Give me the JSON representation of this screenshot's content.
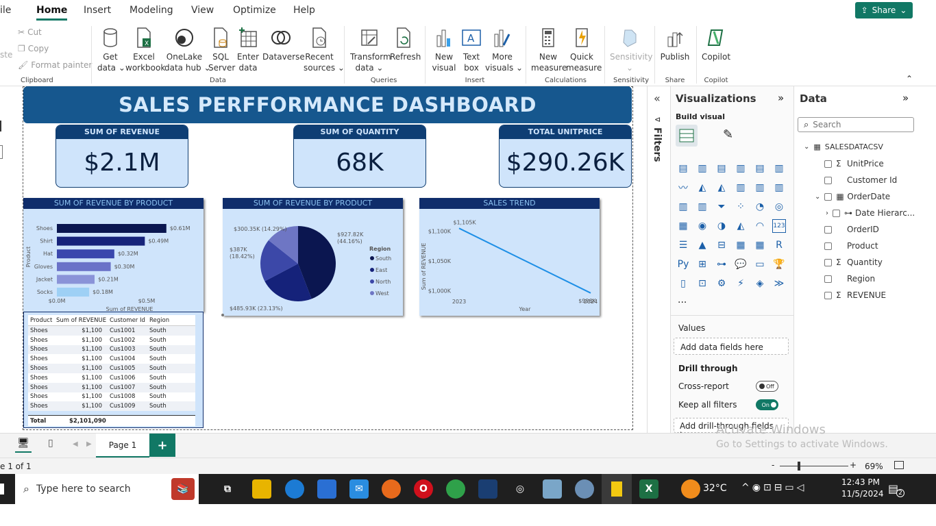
{
  "menu": {
    "file": "ile",
    "home": "Home",
    "insert": "Insert",
    "modeling": "Modeling",
    "view": "View",
    "optimize": "Optimize",
    "help": "Help",
    "share": "Share"
  },
  "ribbon": {
    "clipboard": {
      "paste": "ste",
      "cut": "Cut",
      "copy": "Copy",
      "format_painter": "Format painter",
      "group": "Clipboard"
    },
    "data": {
      "get_data": "Get\ndata ⌄",
      "excel": "Excel\nworkbook",
      "onelake": "OneLake\ndata hub ⌄",
      "sql": "SQL\nServer",
      "enter": "Enter\ndata",
      "dataverse": "Dataverse",
      "recent": "Recent\nsources ⌄",
      "group": "Data"
    },
    "queries": {
      "transform": "Transform\ndata ⌄",
      "refresh": "Refresh",
      "group": "Queries"
    },
    "insert": {
      "new_visual": "New\nvisual",
      "text_box": "Text\nbox",
      "more_visuals": "More\nvisuals ⌄",
      "group": "Insert"
    },
    "calculations": {
      "new_measure": "New\nmeasure",
      "quick_measure": "Quick\nmeasure",
      "group": "Calculations"
    },
    "sensitivity": {
      "label": "Sensitivity\n⌄",
      "group": "Sensitivity"
    },
    "share": {
      "publish": "Publish",
      "group": "Share"
    },
    "copilot": {
      "label": "Copilot",
      "group": "Copilot"
    }
  },
  "dashboard": {
    "title": "SALES PERFFORMANCE DASHBOARD",
    "kpis": [
      {
        "label": "SUM OF REVENUE",
        "value": "$2.1M"
      },
      {
        "label": "SUM OF QUANTITY",
        "value": "68K"
      },
      {
        "label": "TOTAL UNITPRICE",
        "value": "$290.26K"
      }
    ]
  },
  "chart_data": [
    {
      "type": "bar",
      "title": "SUM OF REVENUE BY PRODUCT",
      "orientation": "horizontal",
      "categories": [
        "Shoes",
        "Shirt",
        "Hat",
        "Gloves",
        "Jacket",
        "Socks"
      ],
      "values": [
        0.61,
        0.49,
        0.32,
        0.3,
        0.21,
        0.18
      ],
      "data_labels": [
        "$0.61M",
        "$0.49M",
        "$0.32M",
        "$0.30M",
        "$0.21M",
        "$0.18M"
      ],
      "xticks": [
        "$0.0M",
        "$0.5M"
      ],
      "xlabel": "Sum of REVENUE",
      "ylabel": "Product",
      "xlim": [
        0,
        0.75
      ],
      "colors": [
        "#0a1650",
        "#16237a",
        "#3a47ad",
        "#6a72c8",
        "#8a93d8",
        "#9ed0f5"
      ]
    },
    {
      "type": "pie",
      "title": "SUM OF REVENUE BY PRODUCT",
      "legend_title": "Region",
      "legend_position": "right",
      "slices": [
        {
          "name": "South",
          "value": 927.82,
          "label": "$927.82K\n(44.16%)",
          "color": "#0b1650"
        },
        {
          "name": "East",
          "value": 485.93,
          "label": "$485.93K (23.13%)",
          "color": "#15227a"
        },
        {
          "name": "North",
          "value": 387,
          "label": "$387K\n(18.42%)",
          "color": "#3c48a8"
        },
        {
          "name": "West",
          "value": 300.35,
          "label": "$300.35K (14.29%)",
          "color": "#6e76c4"
        }
      ]
    },
    {
      "type": "line",
      "title": "SALES TREND",
      "x": [
        "2023",
        "2024"
      ],
      "y": [
        1105,
        996
      ],
      "point_labels": [
        "$1,105K",
        "$996K"
      ],
      "yticks": [
        "$1,100K",
        "$1,050K",
        "$1,000K"
      ],
      "ytick_values": [
        1100,
        1050,
        1000
      ],
      "ylim": [
        990,
        1110
      ],
      "xlabel": "Year",
      "ylabel": "Sum of REVENUE",
      "color": "#1e8fe6"
    },
    {
      "type": "table",
      "columns": [
        "Product",
        "Sum of REVENUE",
        "Customer Id",
        "Region"
      ],
      "rows": [
        [
          "Shoes",
          "$1,100",
          "Cus1001",
          "South"
        ],
        [
          "Shoes",
          "$1,100",
          "Cus1002",
          "South"
        ],
        [
          "Shoes",
          "$1,100",
          "Cus1003",
          "South"
        ],
        [
          "Shoes",
          "$1,100",
          "Cus1004",
          "South"
        ],
        [
          "Shoes",
          "$1,100",
          "Cus1005",
          "South"
        ],
        [
          "Shoes",
          "$1,100",
          "Cus1006",
          "South"
        ],
        [
          "Shoes",
          "$1,100",
          "Cus1007",
          "South"
        ],
        [
          "Shoes",
          "$1,100",
          "Cus1008",
          "South"
        ],
        [
          "Shoes",
          "$1,100",
          "Cus1009",
          "South"
        ]
      ],
      "total_label": "Total",
      "total_value": "$2,101,090"
    }
  ],
  "filters": {
    "label": "Filters"
  },
  "viz_pane": {
    "title": "Visualizations",
    "build_visual": "Build visual",
    "values": "Values",
    "values_placeholder": "Add data fields here",
    "drill_through": "Drill through",
    "cross_report": "Cross-report",
    "cross_report_state": "Off",
    "keep_filters": "Keep all filters",
    "keep_filters_state": "On",
    "drill_placeholder": "Add drill-through fields here",
    "more": "..."
  },
  "data_pane": {
    "title": "Data",
    "search_placeholder": "Search",
    "table": "SALESDATACSV",
    "fields": [
      {
        "name": "UnitPrice",
        "sigma": true
      },
      {
        "name": "Customer Id",
        "sigma": false
      },
      {
        "name": "OrderDate",
        "sigma": false
      },
      {
        "name": "Date Hierarc...",
        "sigma": false
      },
      {
        "name": "OrderID",
        "sigma": false
      },
      {
        "name": "Product",
        "sigma": false
      },
      {
        "name": "Quantity",
        "sigma": true
      },
      {
        "name": "Region",
        "sigma": false
      },
      {
        "name": "REVENUE",
        "sigma": true
      }
    ]
  },
  "pages": {
    "current": "Page 1",
    "add": "+"
  },
  "status": {
    "page": "e 1 of 1",
    "zoom": "69%",
    "minus": "-",
    "plus": "+"
  },
  "watermark": {
    "line1": "Activate Windows",
    "line2": "Go to Settings to activate Windows."
  },
  "taskbar": {
    "search": "Type here to search",
    "temp": "32°C",
    "time": "12:43 PM",
    "date": "11/5/2024",
    "notif": "2"
  }
}
